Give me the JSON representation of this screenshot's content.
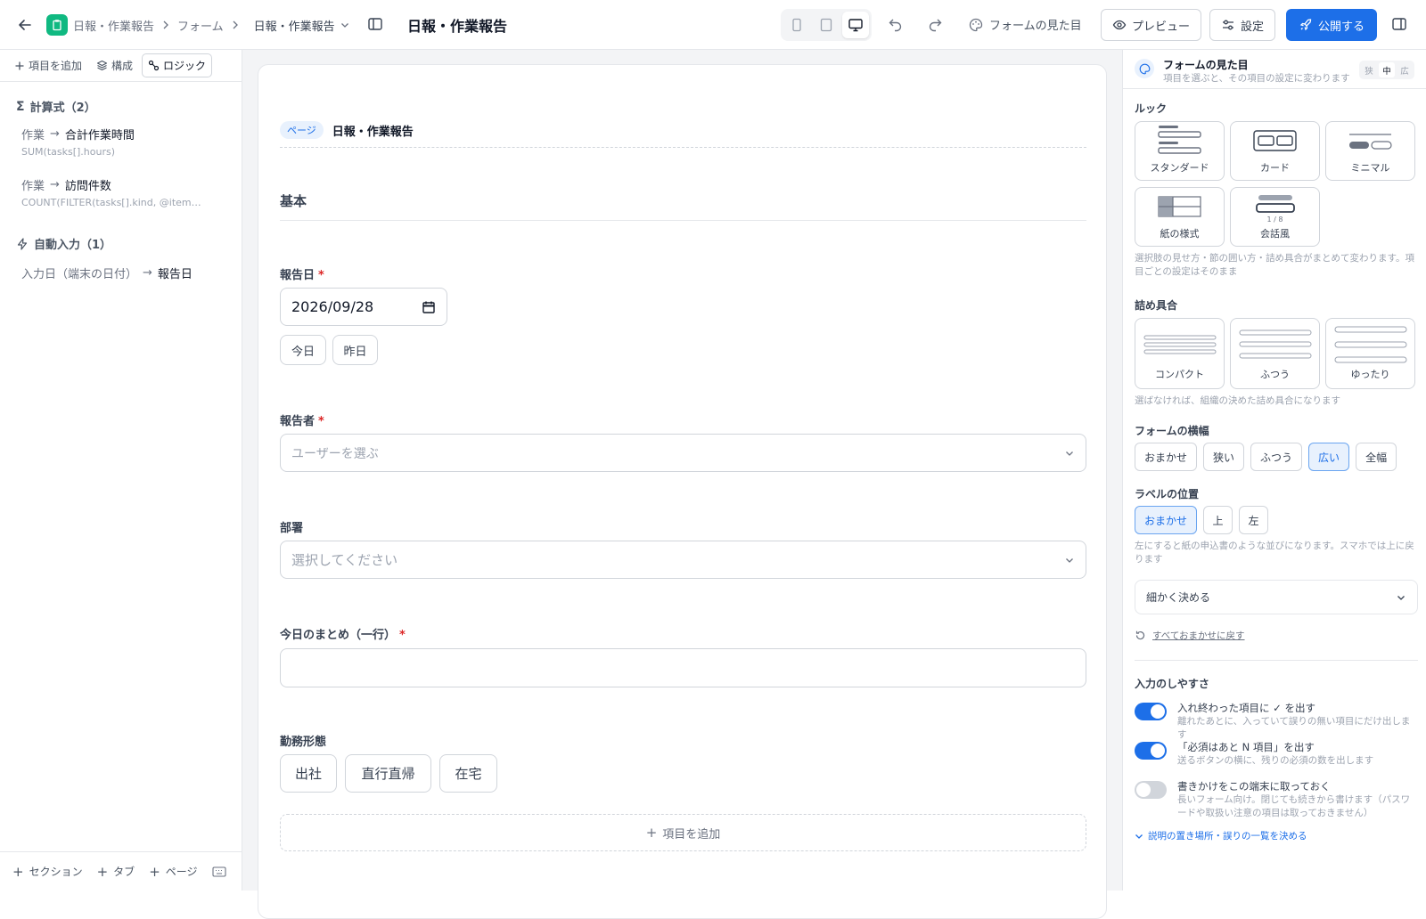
{
  "header": {
    "app_crumb": "日報・作業報告",
    "forms_crumb": "フォーム",
    "form_switch": "日報・作業報告",
    "title": "日報・作業報告",
    "appearance": "フォームの見た目",
    "preview": "プレビュー",
    "settings": "設定",
    "publish": "公開する"
  },
  "left": {
    "tabs": [
      {
        "label": "項目を追加"
      },
      {
        "label": "構成"
      },
      {
        "label": "ロジック"
      }
    ],
    "formulas_heading": "計算式（2）",
    "formulas": [
      {
        "section": "作業",
        "target": "合計作業時間",
        "expr": "SUM(tasks[].hours)"
      },
      {
        "section": "作業",
        "target": "訪問件数",
        "expr": "COUNT(FILTER(tasks[].kind, @item == '…"
      }
    ],
    "autofill_heading": "自動入力（1）",
    "autofill": [
      {
        "source": "入力日（端末の日付）",
        "target": "報告日"
      }
    ],
    "footer": {
      "section": "セクション",
      "tab": "タブ",
      "page": "ページ"
    }
  },
  "form": {
    "page_badge": "ページ",
    "page_title": "日報・作業報告",
    "section_title": "基本",
    "date_label": "報告日",
    "date_value": "2026/09/28",
    "quick_dates": [
      "今日",
      "昨日"
    ],
    "reporter_label": "報告者",
    "reporter_placeholder": "ユーザーを選ぶ",
    "dept_label": "部署",
    "dept_placeholder": "選択してください",
    "summary_label": "今日のまとめ（一行）",
    "summary_value": "",
    "work_label": "勤務形態",
    "work_options": [
      "出社",
      "直行直帰",
      "在宅"
    ],
    "add_item": "項目を追加"
  },
  "panel": {
    "title": "フォームの見た目",
    "subtitle": "項目を選ぶと、その項目の設定に変わります",
    "size_toggle": [
      "狭",
      "中",
      "広"
    ],
    "size_selected": "中",
    "look_heading": "ルック",
    "looks": [
      "スタンダード",
      "カード",
      "ミニマル",
      "紙の様式",
      "会話風"
    ],
    "look_step": "1 / 8",
    "look_note": "選択肢の見せ方・節の囲い方・詰め具合がまとめて変わります。項目ごとの設定はそのまま",
    "density_heading": "詰め具合",
    "densities": [
      "コンパクト",
      "ふつう",
      "ゆったり"
    ],
    "density_note": "選ばなければ、組織の決めた詰め具合になります",
    "width_heading": "フォームの横幅",
    "widths": [
      "おまかせ",
      "狭い",
      "ふつう",
      "広い",
      "全幅"
    ],
    "width_selected": "広い",
    "labelpos_heading": "ラベルの位置",
    "labelpos": [
      "おまかせ",
      "上",
      "左"
    ],
    "labelpos_selected": "おまかせ",
    "labelpos_note": "左にすると紙の申込書のような並びになります。スマホでは上に戻ります",
    "detail_select": "細かく決める",
    "reset": "すべておまかせに戻す",
    "ease_heading": "入力のしやすさ",
    "toggles": [
      {
        "title": "入れ終わった項目に ✓ を出す",
        "sub": "離れたあとに、入っていて誤りの無い項目にだけ出します",
        "on": true
      },
      {
        "title": "「必須はあと N 項目」を出す",
        "sub": "送るボタンの横に、残りの必須の数を出します",
        "on": true
      },
      {
        "title": "書きかけをこの端末に取っておく",
        "sub": "長いフォーム向け。閉じても続きから書けます（パスワードや取扱い注意の項目は取っておきません）",
        "on": false
      }
    ],
    "more_link": "説明の置き場所・誤りの一覧を決める"
  },
  "colors": {
    "accent": "#1d6fe8",
    "brand_icon": "#10b981",
    "required": "#dc2626"
  }
}
